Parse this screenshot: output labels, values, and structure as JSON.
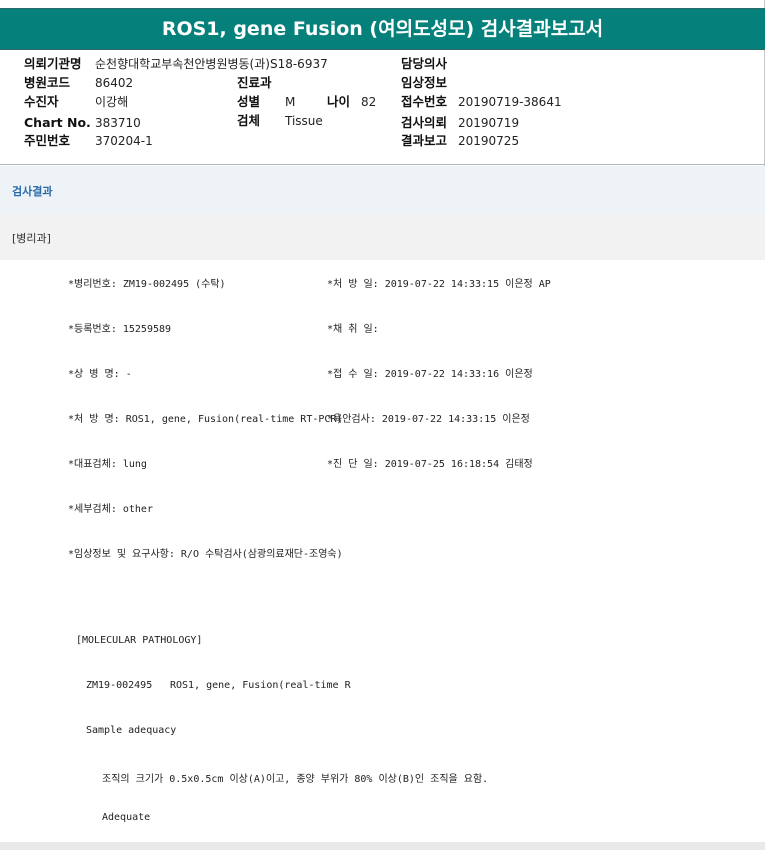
{
  "report": {
    "title": "ROS1, gene Fusion (여의도성모) 검사결과보고서"
  },
  "header": {
    "institution_label": "의뢰기관명",
    "institution_value": "순천향대학교부속천안병원병동(과)S18-6937",
    "doctor_label": "담당의사",
    "doctor_value": "",
    "hospital_code_label": "병원코드",
    "hospital_code_value": "86402",
    "dept_label": "진료과",
    "dept_value": "",
    "clinical_info_label": "임상정보",
    "clinical_info_value": "",
    "patient_label": "수진자",
    "patient_value": "이강해",
    "sex_label": "성별",
    "sex_value": "M",
    "age_label": "나이",
    "age_value": "82",
    "receipt_label": "접수번호",
    "receipt_value": "20190719-38641",
    "chart_label": "Chart No.",
    "chart_value": "383710",
    "specimen_label": "검체",
    "specimen_value": "Tissue",
    "request_label": "검사의뢰",
    "request_value": "20190719",
    "id_label": "주민번호",
    "id_value": "370204-1",
    "report_label": "결과보고",
    "report_value": "20190725"
  },
  "results": {
    "section_title": "검사결과",
    "subsection_title": "[병리과]",
    "rows": [
      {
        "left": "*병리번호: ZM19-002495 (수탁)",
        "right": "*처 방 일: 2019-07-22 14:33:15  이은정 AP"
      },
      {
        "left": "*등록번호: 15259589",
        "right": "*채 취 일:"
      },
      {
        "left": "*상 병 명: -",
        "right": "*접 수 일: 2019-07-22 14:33:16  이은정"
      },
      {
        "left": "*처 방 명: ROS1, gene, Fusion(real-time RT-PCR)",
        "right": "*육안검사: 2019-07-22 14:33:15  이은정"
      },
      {
        "left": "*대표검체: lung",
        "right": "*진 단 일: 2019-07-25 16:18:54  김태정"
      },
      {
        "left": "*세부검체: other",
        "right": ""
      },
      {
        "left": "*임상정보 및 요구사항: R/O 수탁검사(삼광의료재단-조영숙)",
        "right": ""
      },
      {
        "left": "",
        "right": ""
      }
    ],
    "molecular_title": "[MOLECULAR PATHOLOGY]",
    "case_no": "ZM19-002495",
    "case_test": "ROS1, gene, Fusion(real-time R",
    "adequacy_title": "Sample adequacy",
    "adequacy_criteria": "조직의 크기가 0.5x0.5cm 이상(A)이고, 종양 부위가 80% 이상(B)인 조직을 요함.",
    "adequacy_result": "Adequate"
  }
}
